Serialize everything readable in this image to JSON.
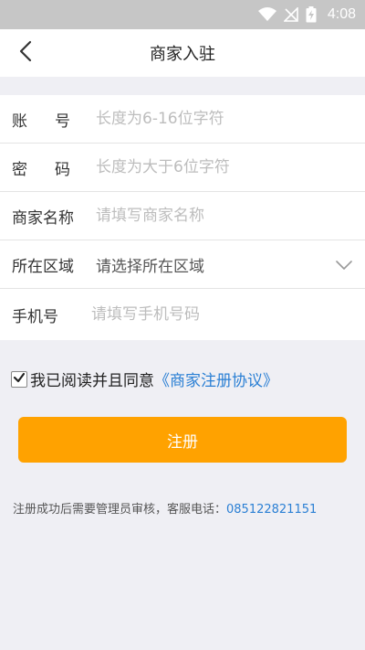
{
  "status_bar": {
    "time": "4:08"
  },
  "header": {
    "title": "商家入驻"
  },
  "form": {
    "account": {
      "label": "账号",
      "placeholder": "长度为6-16位字符"
    },
    "password": {
      "label": "密码",
      "placeholder": "长度为大于6位字符"
    },
    "merchant_name": {
      "label": "商家名称",
      "placeholder": "请填写商家名称"
    },
    "region": {
      "label": "所在区域",
      "value": "请选择所在区域"
    },
    "phone": {
      "label": "手机号",
      "placeholder": "请填写手机号码"
    }
  },
  "agreement": {
    "checked": true,
    "text": "我已阅读并且同意",
    "link": "《商家注册协议》"
  },
  "register_button": {
    "label": "注册"
  },
  "note": {
    "text": "注册成功后需要管理员审核，客服电话：",
    "phone": "085122821151"
  },
  "colors": {
    "accent": "#ffa200",
    "link": "#2a7fd4",
    "status_bar": "#c6c6c6"
  }
}
